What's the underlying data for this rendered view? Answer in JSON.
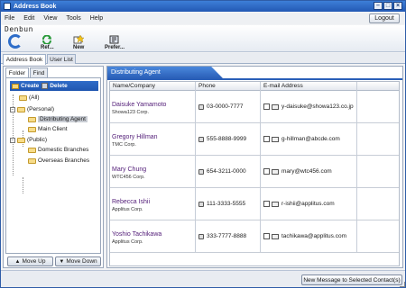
{
  "window": {
    "title": "Address Book"
  },
  "menu": {
    "items": [
      "File",
      "Edit",
      "View",
      "Tools",
      "Help"
    ]
  },
  "header": {
    "logout_label": "Logout"
  },
  "brand": {
    "name": "Denbun",
    "tagline": ""
  },
  "toolbar": {
    "refresh_label": "Ref...",
    "new_label": "New",
    "preferences_label": "Prefer..."
  },
  "subtabs": [
    {
      "label": "Address Book",
      "active": true
    },
    {
      "label": "User List",
      "active": false
    }
  ],
  "left_panel": {
    "tabs": [
      {
        "label": "Folder",
        "active": true
      },
      {
        "label": "Find",
        "active": false
      }
    ],
    "create_label": "Create",
    "delete_label": "Delete",
    "tree": [
      {
        "label": "(All)",
        "level": 1,
        "expander": ""
      },
      {
        "label": "(Personal)",
        "level": 0,
        "expander": "−"
      },
      {
        "label": "Distributing Agent",
        "level": 1,
        "expander": "",
        "selected": true
      },
      {
        "label": "Main Client",
        "level": 1,
        "expander": ""
      },
      {
        "label": "(Public)",
        "level": 0,
        "expander": "−"
      },
      {
        "label": "Domestic Branches",
        "level": 1,
        "expander": ""
      },
      {
        "label": "Overseas Branches",
        "level": 1,
        "expander": ""
      }
    ],
    "move_up_label": "Move Up",
    "move_down_label": "Move Down"
  },
  "main": {
    "group_title": "Distributing Agent",
    "columns": {
      "name": "Name/Company",
      "phone": "Phone",
      "email": "E-mail Address"
    },
    "contacts": [
      {
        "name": "Daisuke Yamamoto",
        "company": "Showa123 Corp.",
        "phone": "03-0000-7777",
        "email": "y-daisuke@showa123.co.jp"
      },
      {
        "name": "Gregory Hillman",
        "company": "TMC Corp.",
        "phone": "555-8888-9999",
        "email": "g-hillman@abcde.com"
      },
      {
        "name": "Mary Chung",
        "company": "WTC456 Corp.",
        "phone": "654-3211-0000",
        "email": "mary@wtc456.com"
      },
      {
        "name": "Rebecca Ishii",
        "company": "Applitus Corp.",
        "phone": "111-3333-5555",
        "email": "r-ishii@applitus.com"
      },
      {
        "name": "Yoshio Tachikawa",
        "company": "Applitus Corp.",
        "phone": "333-7777-8888",
        "email": "tachikawa@applitus.com"
      }
    ]
  },
  "status": {
    "new_message_label": "New Message to Selected Contact(s)"
  },
  "colors": {
    "accent": "#2a5fb8",
    "name_text": "#55207a",
    "selected_bg": "#c8ccd3"
  }
}
